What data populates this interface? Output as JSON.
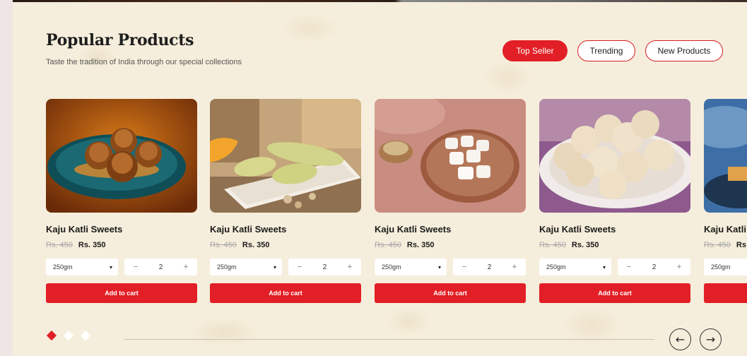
{
  "section": {
    "title": "Popular Products",
    "subtitle": "Taste the tradition of India through our special collections"
  },
  "filters": [
    {
      "label": "Top Seller",
      "active": true
    },
    {
      "label": "Trending",
      "active": false
    },
    {
      "label": "New Products",
      "active": false
    }
  ],
  "products": [
    {
      "name": "Kaju Katli Sweets",
      "old_price": "Rs. 450",
      "price": "Rs. 350",
      "weight": "250gm",
      "qty": "2",
      "cta": "Add to cart",
      "image": "round-fried-sweets-on-blue-plate"
    },
    {
      "name": "Kaju Katli Sweets",
      "old_price": "Rs. 450",
      "price": "Rs. 350",
      "weight": "250gm",
      "qty": "2",
      "cta": "Add to cart",
      "image": "pista-rolls-on-white-tray"
    },
    {
      "name": "Kaju Katli Sweets",
      "old_price": "Rs. 450",
      "price": "Rs. 350",
      "weight": "250gm",
      "qty": "2",
      "cta": "Add to cart",
      "image": "white-sweets-on-copper-plate"
    },
    {
      "name": "Kaju Katli Sweets",
      "old_price": "Rs. 450",
      "price": "Rs. 350",
      "weight": "250gm",
      "qty": "2",
      "cta": "Add to cart",
      "image": "coconut-ladoos-on-plate"
    },
    {
      "name": "Kaju Katli Sweets",
      "old_price": "Rs. 450",
      "price": "Rs",
      "weight": "250gm",
      "qty": "",
      "cta": "",
      "image": "sweets-on-blue-background"
    }
  ],
  "stepper": {
    "minus": "−",
    "plus": "+",
    "caret": "▾"
  },
  "pagination": {
    "active_index": 0,
    "count": 3
  },
  "nav": {
    "prev_icon": "←",
    "next_icon": "→"
  },
  "colors": {
    "accent": "#e21f26",
    "background": "#f6eedc"
  }
}
